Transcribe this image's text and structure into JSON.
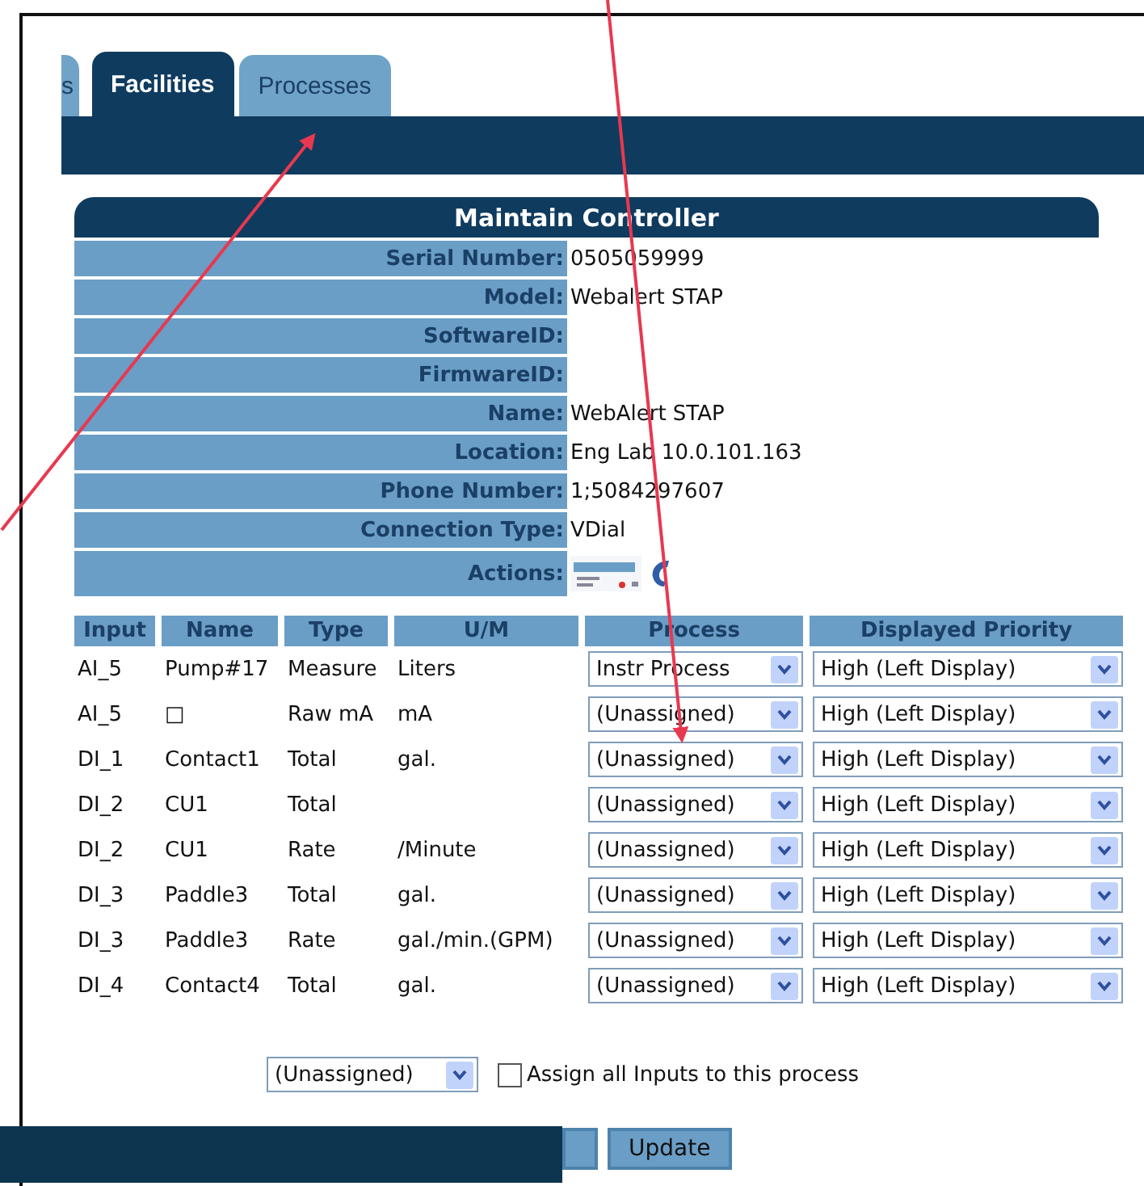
{
  "tabs": [
    {
      "label": "s",
      "selected": false
    },
    {
      "label": "Facilities",
      "selected": true
    },
    {
      "label": "Processes",
      "selected": false
    }
  ],
  "panel": {
    "title": "Maintain Controller",
    "fields": [
      {
        "kind": "text",
        "label": "Serial Number:",
        "value": "0505059999"
      },
      {
        "kind": "text",
        "label": "Model:",
        "value": "Webalert STAP"
      },
      {
        "kind": "text",
        "label": "SoftwareID:"
      },
      {
        "kind": "text",
        "label": "FirmwareID:"
      },
      {
        "kind": "text",
        "label": "Name:",
        "value": "WebAlert STAP"
      },
      {
        "kind": "text",
        "label": "Location:",
        "value": "Eng Lab 10.0.101.163"
      },
      {
        "kind": "text",
        "label": "Phone Number:",
        "value": "1;5084297607"
      },
      {
        "kind": "text",
        "label": "Connection Type:",
        "value": "VDial"
      },
      {
        "kind": "actions",
        "label": "Actions:"
      }
    ]
  },
  "inputs_table": {
    "columns": [
      "Input",
      "Name",
      "Type",
      "U/M",
      "Process",
      "Displayed Priority"
    ],
    "rows": [
      {
        "input": "AI_5",
        "name": "Pump#17",
        "type": "Measure",
        "um": "Liters",
        "process": "Instr Process",
        "priority": "High (Left Display)"
      },
      {
        "input": "AI_5",
        "name": "□",
        "type": "Raw mA",
        "um": "mA",
        "process": "(Unassigned)",
        "priority": "High (Left Display)"
      },
      {
        "input": "DI_1",
        "name": "Contact1",
        "type": "Total",
        "um": "gal.",
        "process": "(Unassigned)",
        "priority": "High (Left Display)"
      },
      {
        "input": "DI_2",
        "name": "CU1",
        "type": "Total",
        "process": "(Unassigned)",
        "priority": "High (Left Display)"
      },
      {
        "input": "DI_2",
        "name": "CU1",
        "type": "Rate",
        "um": "/Minute",
        "process": "(Unassigned)",
        "priority": "High (Left Display)"
      },
      {
        "input": "DI_3",
        "name": "Paddle3",
        "type": "Total",
        "um": "gal.",
        "process": "(Unassigned)",
        "priority": "High (Left Display)"
      },
      {
        "input": "DI_3",
        "name": "Paddle3",
        "type": "Rate",
        "um": "gal./min.(GPM)",
        "process": "(Unassigned)",
        "priority": "High (Left Display)"
      },
      {
        "input": "DI_4",
        "name": "Contact4",
        "type": "Total",
        "um": "gal.",
        "process": "(Unassigned)",
        "priority": "High (Left Display)"
      }
    ]
  },
  "assign": {
    "process": "(Unassigned)",
    "checkbox_label": "Assign all Inputs to this process",
    "checked": false
  },
  "buttons": [
    "Update"
  ]
}
